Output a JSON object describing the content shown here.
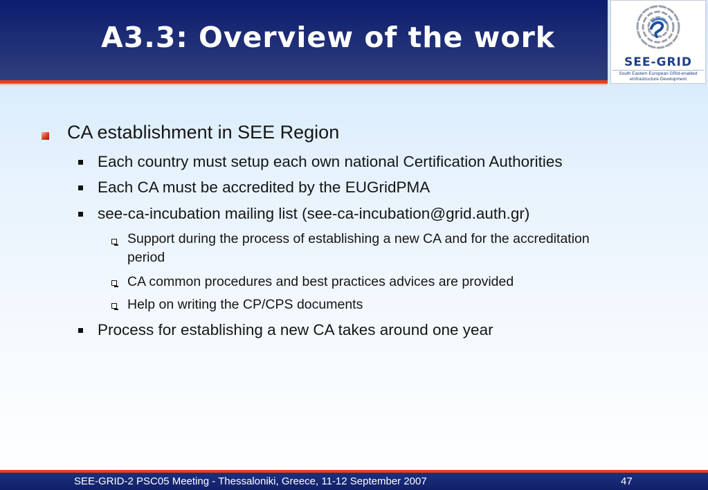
{
  "slide": {
    "title": "A3.3: Overview of the work",
    "logo": {
      "name": "SEE-GRID",
      "tagline_line1": "South Eastern European GRid-enabled",
      "tagline_line2": "eInfrastructure Development"
    },
    "bullets": {
      "level1": "CA establishment in SEE Region",
      "level2": [
        "Each country must setup each own national Certification Authorities",
        "Each CA must be accredited by the EUGridPMA",
        "see-ca-incubation mailing list (see-ca-incubation@grid.auth.gr)",
        "Process for establishing a new CA takes around one year"
      ],
      "level3": [
        "Support during the process of establishing a new CA and for the accreditation period",
        "CA common procedures and best practices advices are provided",
        "Help on writing the CP/CPS documents"
      ]
    },
    "footer": {
      "text": "SEE-GRID-2 PSC05 Meeting - Thessaloniki, Greece, 11-12 September 2007",
      "page": "47"
    },
    "colors": {
      "header_bg": "#1b2a74",
      "accent_red": "#e8411c",
      "logo_blue": "#1f3e86"
    }
  }
}
